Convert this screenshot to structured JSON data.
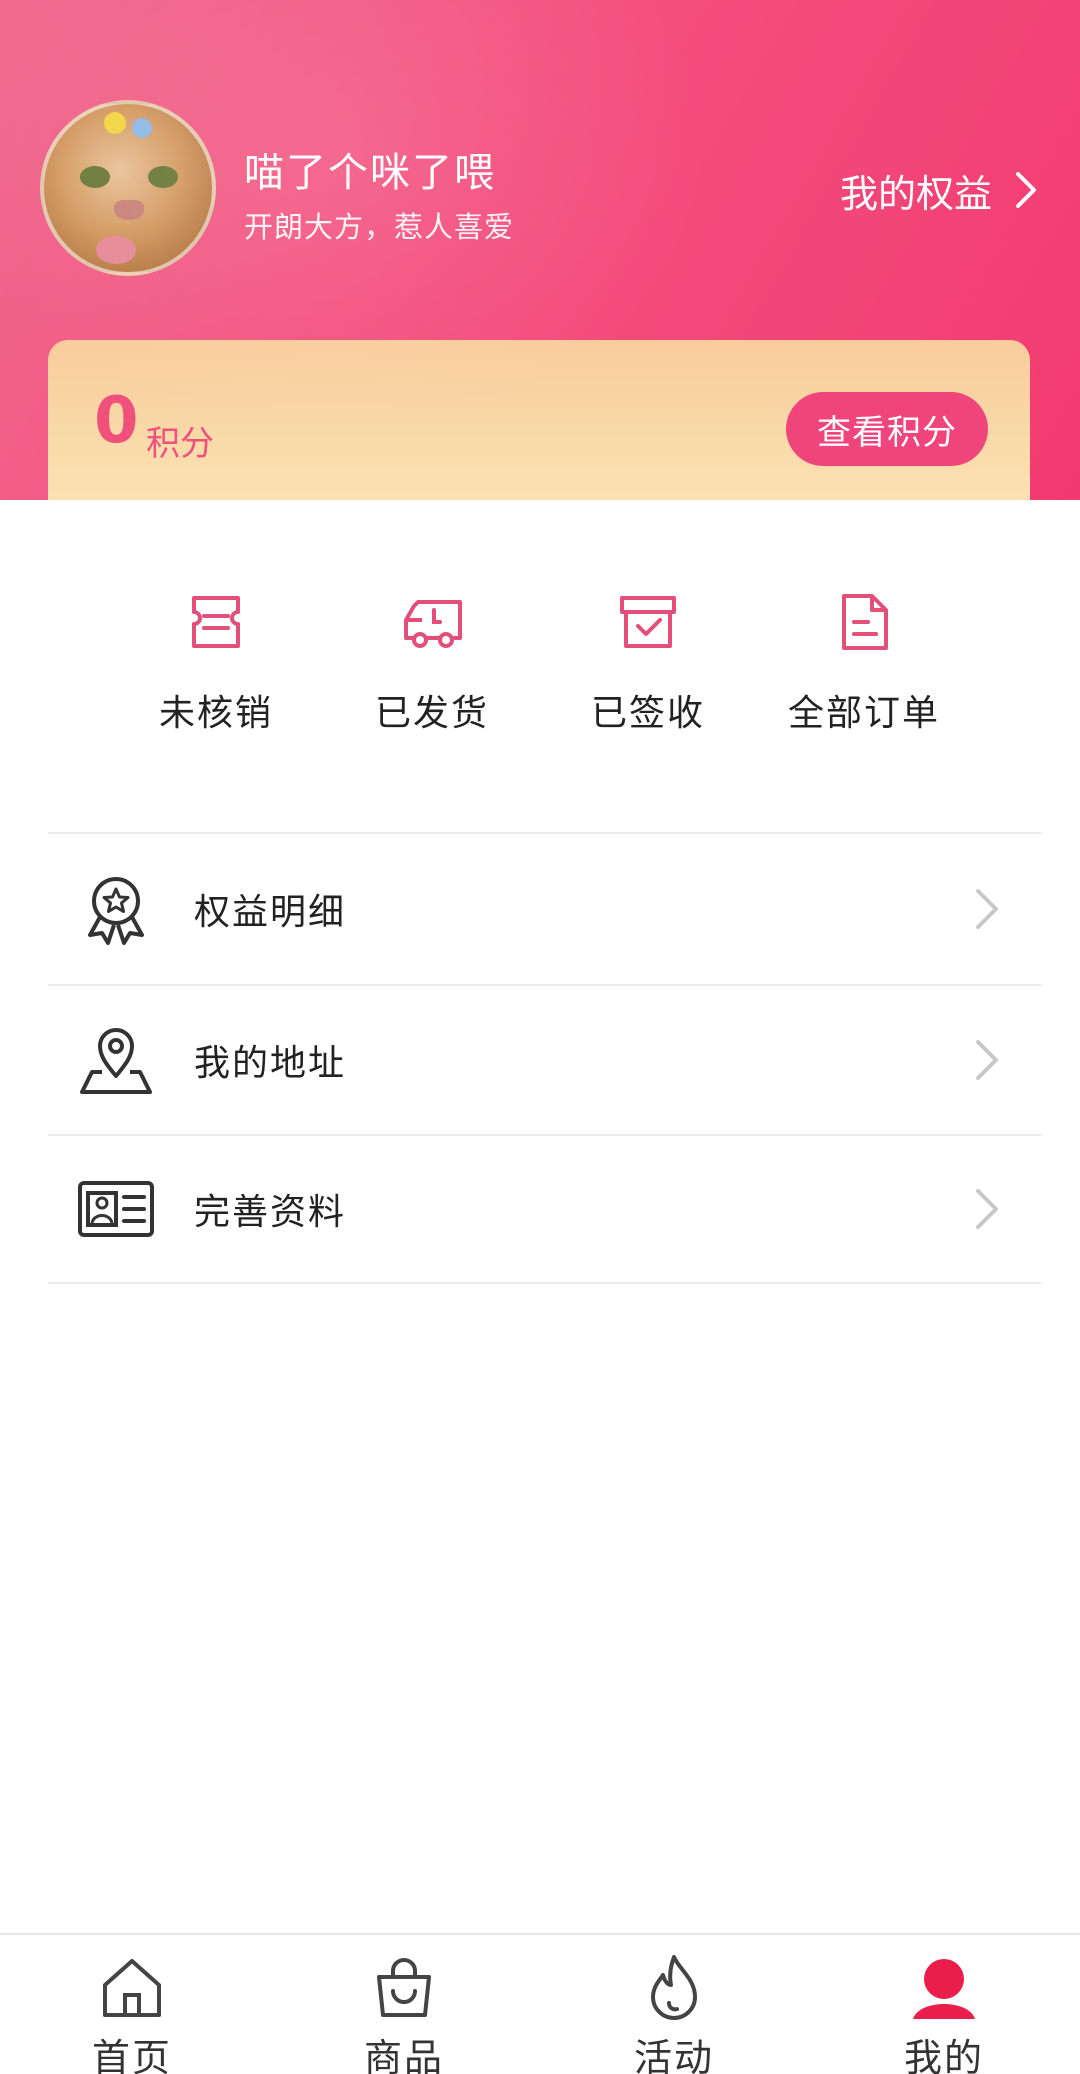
{
  "colors": {
    "brand_pink": "#f23a70",
    "points_card": "#f9d9a8",
    "points_text": "#f0507c",
    "icon_pink": "#e2507a",
    "tab_active": "#ea1e4a"
  },
  "profile": {
    "name": "喵了个咪了喂",
    "motto": "开朗大方，惹人喜爱",
    "rights_link": "我的权益"
  },
  "points": {
    "value": "0",
    "unit": "积分",
    "button": "查看积分"
  },
  "orders": [
    {
      "label": "未核销",
      "icon": "voucher-icon"
    },
    {
      "label": "已发货",
      "icon": "truck-icon"
    },
    {
      "label": "已签收",
      "icon": "box-check-icon"
    },
    {
      "label": "全部订单",
      "icon": "document-icon"
    }
  ],
  "menu": [
    {
      "label": "权益明细",
      "icon": "medal-icon"
    },
    {
      "label": "我的地址",
      "icon": "location-pin-icon"
    },
    {
      "label": "完善资料",
      "icon": "id-card-icon"
    }
  ],
  "tabs": [
    {
      "label": "首页",
      "icon": "home-icon"
    },
    {
      "label": "商品",
      "icon": "shopping-bag-icon"
    },
    {
      "label": "活动",
      "icon": "flame-icon"
    },
    {
      "label": "我的",
      "icon": "user-icon",
      "active": true
    }
  ]
}
